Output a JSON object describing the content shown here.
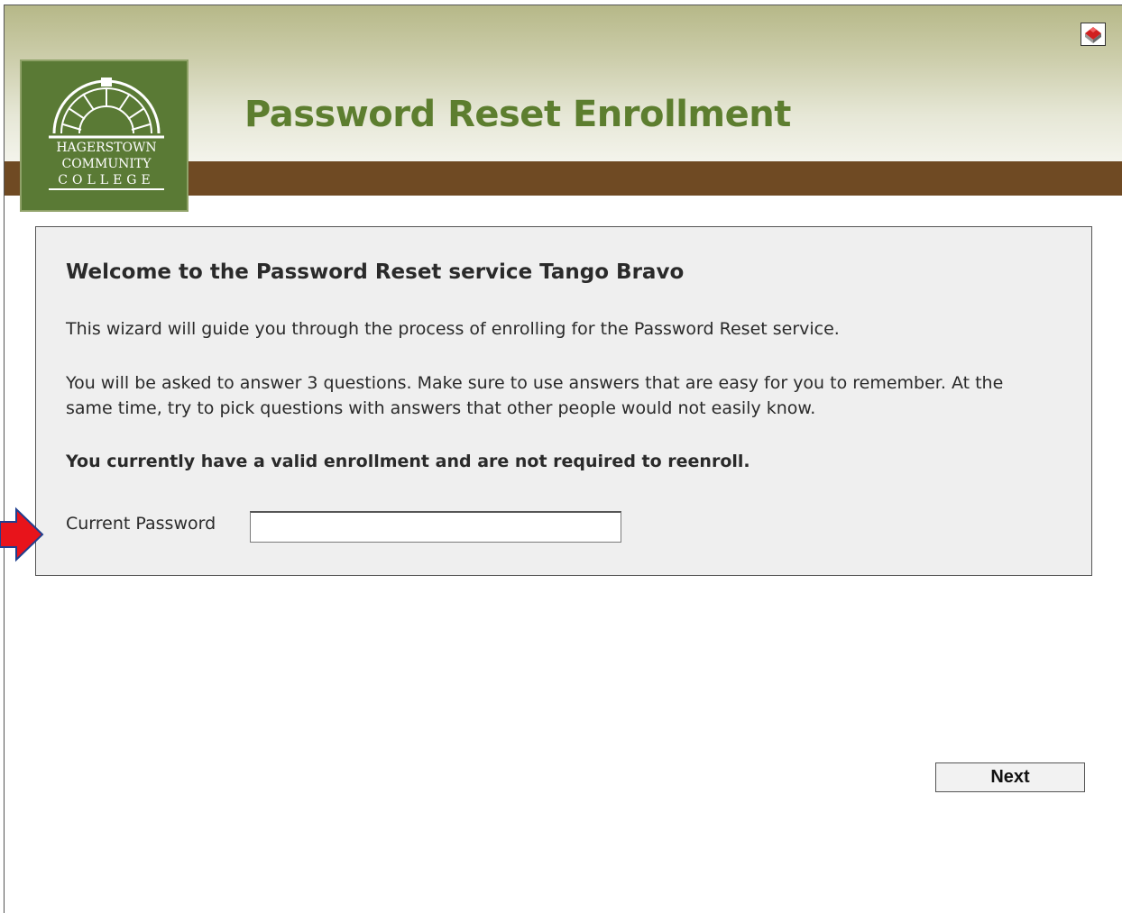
{
  "header": {
    "title": "Password Reset Enrollment",
    "logo": {
      "line1": "HAGERSTOWN",
      "line2": "COMMUNITY",
      "line3": "COLLEGE"
    },
    "corner_icon": "home-icon"
  },
  "panel": {
    "heading": "Welcome to the Password Reset service Tango Bravo",
    "intro": "This wizard will guide you through the process of enrolling for the Password Reset service.",
    "instructions": "You will be asked to answer 3 questions. Make sure to use answers that are easy for you to remember. At the same time, try to pick questions with answers that other people would not easily know.",
    "status": "You currently have a valid enrollment and are not required to reenroll.",
    "password_label": "Current Password",
    "password_value": ""
  },
  "buttons": {
    "next": "Next"
  },
  "colors": {
    "title_green": "#5d7e2f",
    "logo_green": "#5a7a35",
    "band_brown": "#6f4a23",
    "arrow_red": "#e8141b"
  }
}
